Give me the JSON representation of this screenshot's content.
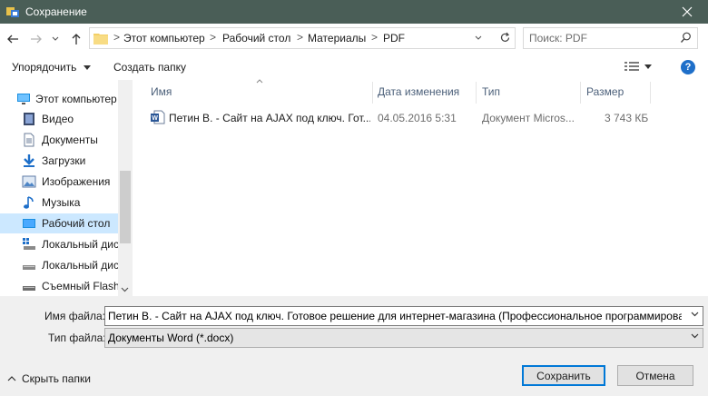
{
  "window": {
    "title": "Сохранение"
  },
  "address": {
    "breadcrumbs": [
      "Этот компьютер",
      "Рабочий стол",
      "Материалы",
      "PDF"
    ],
    "separator": ">"
  },
  "search": {
    "placeholder": "Поиск: PDF"
  },
  "toolbar": {
    "organize_label": "Упорядочить",
    "new_folder_label": "Создать папку",
    "help_label": "?"
  },
  "nav": {
    "items": [
      {
        "label": "Этот компьютер",
        "icon": "computer-icon"
      },
      {
        "label": "Видео",
        "icon": "video-icon"
      },
      {
        "label": "Документы",
        "icon": "documents-icon"
      },
      {
        "label": "Загрузки",
        "icon": "downloads-icon"
      },
      {
        "label": "Изображения",
        "icon": "pictures-icon"
      },
      {
        "label": "Музыка",
        "icon": "music-icon"
      },
      {
        "label": "Рабочий стол",
        "icon": "desktop-icon",
        "selected": true
      },
      {
        "label": "Локальный дис",
        "icon": "drive-icon"
      },
      {
        "label": "Локальный дис",
        "icon": "drive-icon"
      },
      {
        "label": "Съемный Flash-",
        "icon": "usb-drive-icon"
      }
    ]
  },
  "files": {
    "columns": [
      "Имя",
      "Дата изменения",
      "Тип",
      "Размер"
    ],
    "rows": [
      {
        "name": "Петин В. - Сайт на AJAX под ключ. Гот...",
        "date": "04.05.2016 5:31",
        "type": "Документ Micros...",
        "size": "3 743 КБ",
        "icon": "word-document-icon"
      }
    ]
  },
  "form": {
    "filename_label": "Имя файла:",
    "filename_value": "Петин В. - Сайт на AJAX под ключ. Готовое решение для интернет-магазина (Профессиональное программирование) -",
    "filetype_label": "Тип файла:",
    "filetype_value": "Документы Word (*.docx)",
    "hide_folders_label": "Скрыть папки",
    "save_label": "Сохранить",
    "cancel_label": "Отмена"
  },
  "colors": {
    "titlebar": "#4a5e57",
    "selection": "#cce8ff",
    "accent": "#0078d7",
    "header_text": "#4c607a"
  }
}
